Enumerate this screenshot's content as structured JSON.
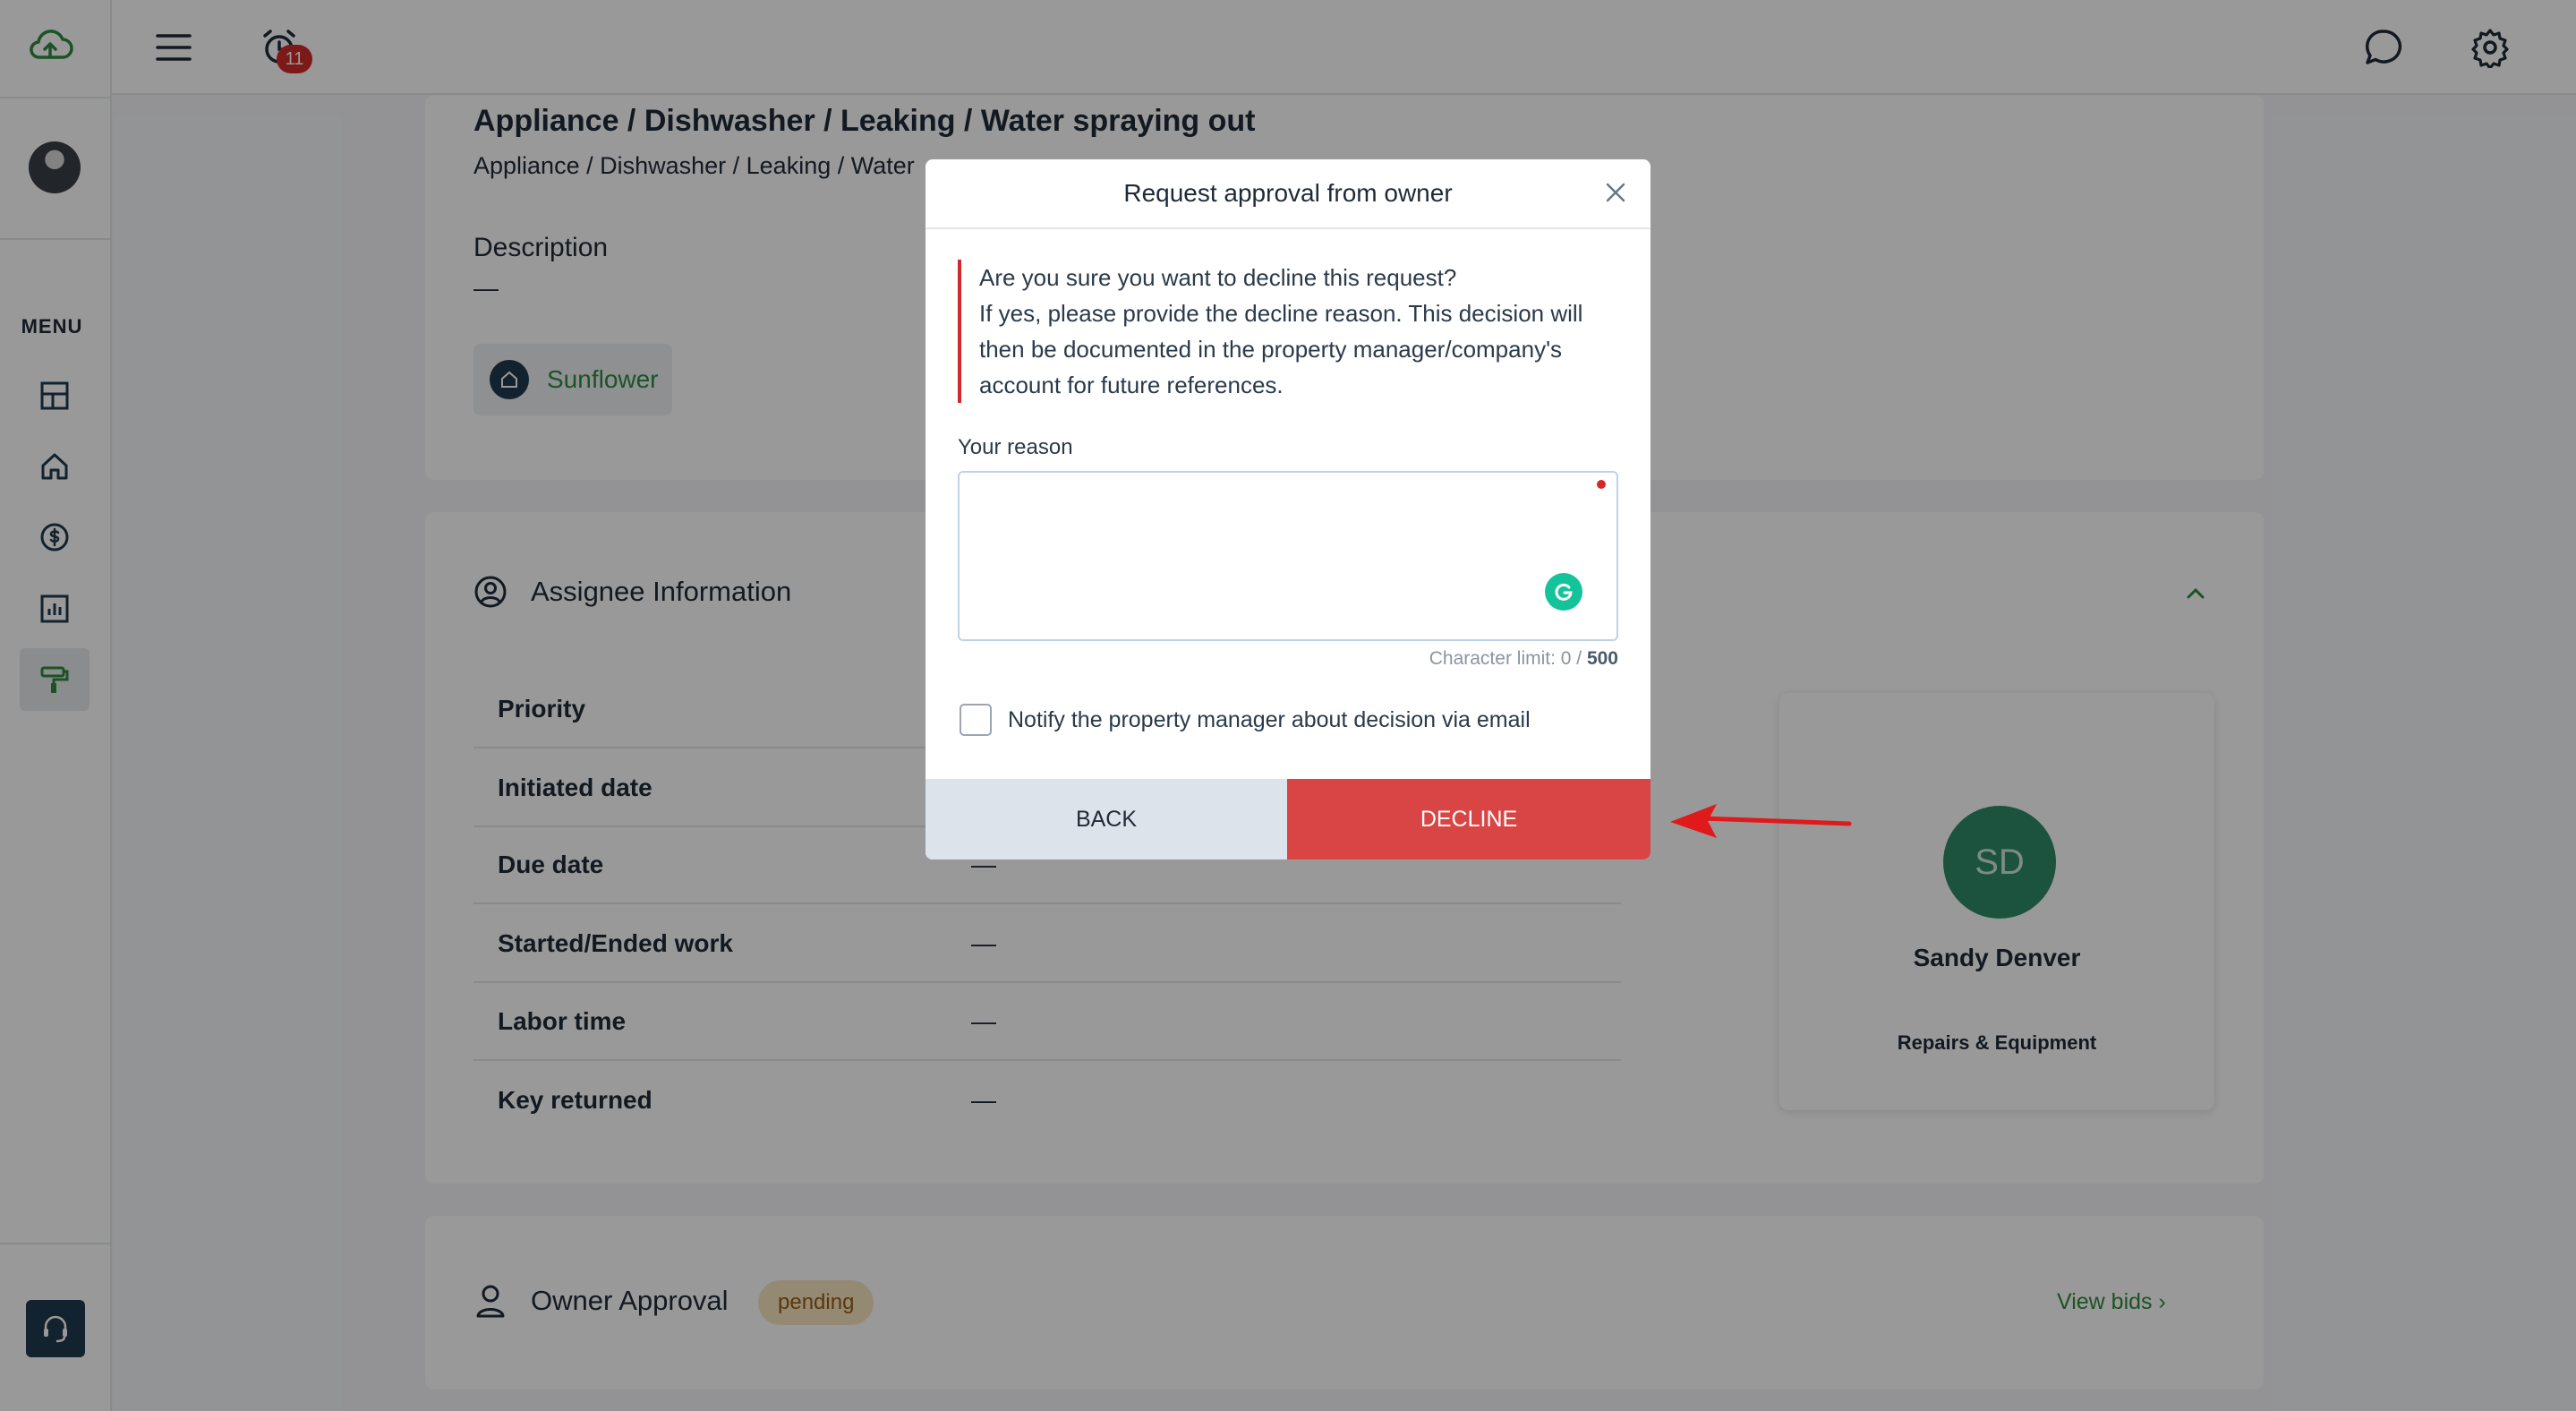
{
  "sidebar": {
    "menu_label": "MENU",
    "items": [
      {
        "icon": "dashboard-icon"
      },
      {
        "icon": "home-icon"
      },
      {
        "icon": "dollar-icon"
      },
      {
        "icon": "reports-icon"
      },
      {
        "icon": "maintenance-icon",
        "active": true
      }
    ]
  },
  "topbar": {
    "notification_count": "11"
  },
  "request": {
    "title": "Appliance / Dishwasher / Leaking / Water spraying out",
    "subtitle": "Appliance / Dishwasher / Leaking / Water",
    "description_label": "Description",
    "description_value": "—",
    "property": "Sunflower"
  },
  "assignee": {
    "section_title": "Assignee Information",
    "rows": [
      {
        "label": "Priority",
        "value": ""
      },
      {
        "label": "Initiated date",
        "value": ""
      },
      {
        "label": "Due date",
        "value": "—"
      },
      {
        "label": "Started/Ended work",
        "value": "—"
      },
      {
        "label": "Labor time",
        "value": "—"
      },
      {
        "label": "Key returned",
        "value": "—"
      }
    ],
    "initials": "SD",
    "name": "Sandy Denver",
    "role": "Repairs & Equipment"
  },
  "owner_approval": {
    "title": "Owner Approval",
    "status": "pending",
    "view_bids": "View bids ›"
  },
  "modal": {
    "title": "Request approval from owner",
    "warning_line1": "Are you sure you want to decline this request?",
    "warning_line2": "If yes, please provide the decline reason. This decision will then be documented in the property manager/company's account for future references.",
    "reason_label": "Your reason",
    "reason_value": "",
    "char_limit_prefix": "Character limit: 0 / ",
    "char_limit_max": "500",
    "notify_label": "Notify the property manager about decision via email",
    "back_label": "BACK",
    "decline_label": "DECLINE"
  },
  "colors": {
    "brand_green": "#2e8b3f",
    "decline_red": "#d94545",
    "badge_red": "#d12a2a"
  }
}
